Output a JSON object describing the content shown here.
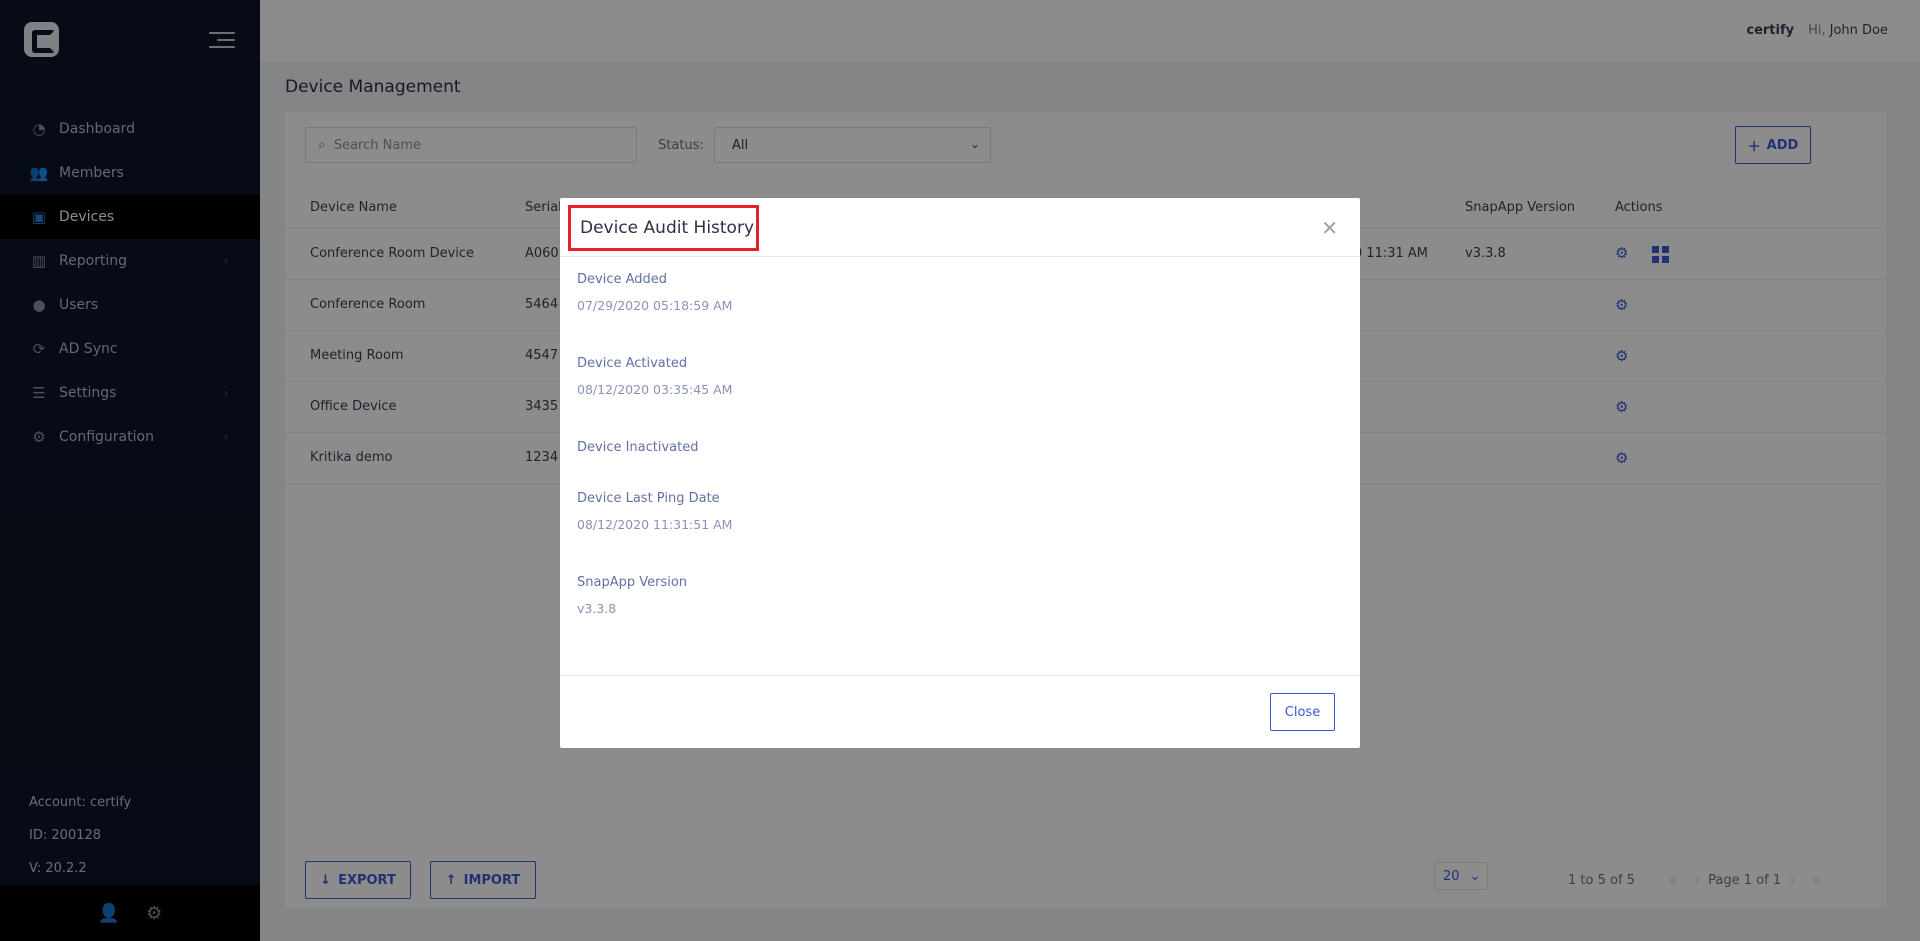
{
  "header": {
    "account": "certify",
    "greeting": "Hi,",
    "user_name": "John Doe"
  },
  "sidebar": {
    "items": [
      {
        "label": "Dashboard",
        "icon": "dashboard-icon",
        "active": false
      },
      {
        "label": "Members",
        "icon": "members-icon",
        "active": false
      },
      {
        "label": "Devices",
        "icon": "tablet-icon",
        "active": true
      },
      {
        "label": "Reporting",
        "icon": "chart-icon",
        "active": false,
        "has_submenu": true
      },
      {
        "label": "Users",
        "icon": "user-icon",
        "active": false
      },
      {
        "label": "AD Sync",
        "icon": "sync-icon",
        "active": false
      },
      {
        "label": "Settings",
        "icon": "sliders-icon",
        "active": false,
        "has_submenu": true
      },
      {
        "label": "Configuration",
        "icon": "gear-icon",
        "active": false,
        "has_submenu": true
      }
    ],
    "account_line": "Account: certify",
    "id_line": "ID: 200128",
    "version_line": "V: 20.2.2"
  },
  "page": {
    "title": "Device Management",
    "search_placeholder": "Search Name",
    "status_label": "Status:",
    "status_value": "All",
    "add_label": "ADD",
    "export_label": "EXPORT",
    "import_label": "IMPORT"
  },
  "table": {
    "columns": {
      "device_name": "Device Name",
      "serial": "Serial",
      "snapapp_version": "SnapApp Version",
      "actions": "Actions"
    },
    "rows": [
      {
        "name": "Conference Room Device",
        "serial": "A060",
        "ping_partial": "0 11:31 AM",
        "version": "v3.3.8",
        "has_tiles": true
      },
      {
        "name": "Conference Room",
        "serial": "5464",
        "ping_partial": "",
        "version": "",
        "has_tiles": false
      },
      {
        "name": "Meeting Room",
        "serial": "4547",
        "ping_partial": "",
        "version": "",
        "has_tiles": false
      },
      {
        "name": "Office Device",
        "serial": "3435",
        "ping_partial": "",
        "version": "",
        "has_tiles": false
      },
      {
        "name": "Kritika demo",
        "serial": "1234",
        "ping_partial": "",
        "version": "",
        "has_tiles": false
      }
    ]
  },
  "pagination": {
    "page_size": "20",
    "range": "1 to 5 of 5",
    "page_label": "Page 1 of 1"
  },
  "modal": {
    "title": "Device Audit History",
    "fields": [
      {
        "label": "Device Added",
        "value": "07/29/2020 05:18:59 AM"
      },
      {
        "label": "Device Activated",
        "value": "08/12/2020 03:35:45 AM"
      },
      {
        "label": "Device Inactivated",
        "value": ""
      },
      {
        "label": "Device Last Ping Date",
        "value": "08/12/2020 11:31:51 AM"
      },
      {
        "label": "SnapApp Version",
        "value": "v3.3.8"
      }
    ],
    "close_label": "Close"
  },
  "colors": {
    "accent": "#3d5ad6",
    "sidebar_bg": "#0d1527",
    "highlight_border": "#e5202e"
  }
}
